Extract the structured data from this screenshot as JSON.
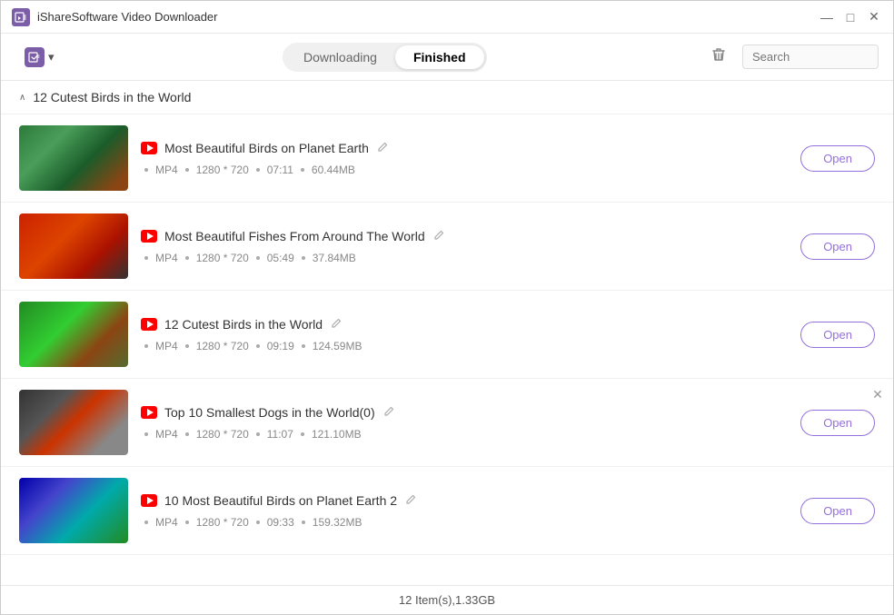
{
  "window": {
    "title": "iShareSoftware Video Downloader"
  },
  "titlebar": {
    "minimize": "—",
    "maximize": "□",
    "close": "✕"
  },
  "toolbar": {
    "add_button_label": "▾",
    "downloading_tab": "Downloading",
    "finished_tab": "Finished",
    "search_placeholder": "Search"
  },
  "group": {
    "title": "12 Cutest Birds in the World",
    "collapse_icon": "∧"
  },
  "videos": [
    {
      "id": "v1",
      "title": "Most Beautiful Birds on Planet Earth",
      "format": "MP4",
      "resolution": "1280 * 720",
      "duration": "07:11",
      "size": "60.44MB",
      "thumb_class": "thumb-1",
      "open_label": "Open"
    },
    {
      "id": "v2",
      "title": "Most Beautiful Fishes From Around The World",
      "format": "MP4",
      "resolution": "1280 * 720",
      "duration": "05:49",
      "size": "37.84MB",
      "thumb_class": "thumb-2",
      "open_label": "Open"
    },
    {
      "id": "v3",
      "title": "12 Cutest Birds in the World",
      "format": "MP4",
      "resolution": "1280 * 720",
      "duration": "09:19",
      "size": "124.59MB",
      "thumb_class": "thumb-3",
      "open_label": "Open"
    },
    {
      "id": "v4",
      "title": "Top 10 Smallest Dogs in the World(0)",
      "format": "MP4",
      "resolution": "1280 * 720",
      "duration": "11:07",
      "size": "121.10MB",
      "thumb_class": "thumb-4",
      "open_label": "Open",
      "show_remove": true
    },
    {
      "id": "v5",
      "title": "10 Most Beautiful Birds on Planet Earth 2",
      "format": "MP4",
      "resolution": "1280 * 720",
      "duration": "09:33",
      "size": "159.32MB",
      "thumb_class": "thumb-5",
      "open_label": "Open"
    }
  ],
  "status_bar": {
    "text": "12 Item(s),1.33GB"
  }
}
